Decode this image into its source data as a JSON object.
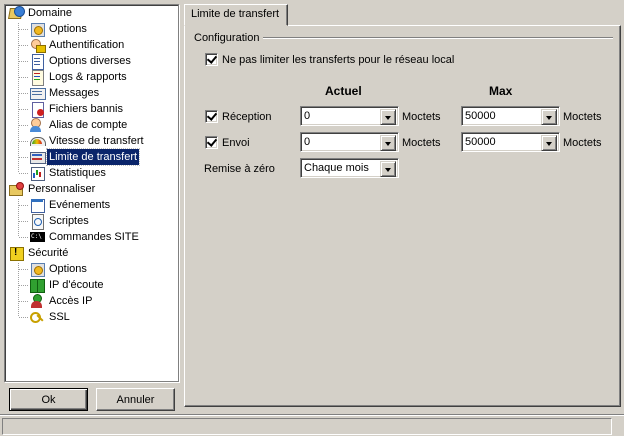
{
  "tree": {
    "items": [
      {
        "label": "Domaine",
        "icon": "domain-icon",
        "level": 0
      },
      {
        "label": "Options",
        "icon": "options-icon",
        "level": 1
      },
      {
        "label": "Authentification",
        "icon": "auth-icon",
        "level": 1
      },
      {
        "label": "Options diverses",
        "icon": "misc-options-icon",
        "level": 1
      },
      {
        "label": "Logs & rapports",
        "icon": "logs-icon",
        "level": 1
      },
      {
        "label": "Messages",
        "icon": "messages-icon",
        "level": 1
      },
      {
        "label": "Fichiers bannis",
        "icon": "banned-files-icon",
        "level": 1
      },
      {
        "label": "Alias de compte",
        "icon": "account-alias-icon",
        "level": 1
      },
      {
        "label": "Vitesse de transfert",
        "icon": "transfer-speed-icon",
        "level": 1
      },
      {
        "label": "Limite de transfert",
        "icon": "transfer-limit-icon",
        "level": 1,
        "selected": true
      },
      {
        "label": "Statistiques",
        "icon": "statistics-icon",
        "level": 1
      },
      {
        "label": "Personnaliser",
        "icon": "customize-icon",
        "level": 0
      },
      {
        "label": "Evénements",
        "icon": "events-icon",
        "level": 1
      },
      {
        "label": "Scriptes",
        "icon": "scripts-icon",
        "level": 1
      },
      {
        "label": "Commandes SITE",
        "icon": "site-commands-icon",
        "level": 1
      },
      {
        "label": "Sécurité",
        "icon": "security-icon",
        "level": 0
      },
      {
        "label": "Options",
        "icon": "security-options-icon",
        "level": 1
      },
      {
        "label": "IP d'écoute",
        "icon": "listen-ip-icon",
        "level": 1
      },
      {
        "label": "Accès IP",
        "icon": "ip-access-icon",
        "level": 1
      },
      {
        "label": "SSL",
        "icon": "ssl-icon",
        "level": 1
      }
    ]
  },
  "buttons": {
    "ok": "Ok",
    "cancel": "Annuler"
  },
  "tab": {
    "label": "Limite de transfert"
  },
  "config": {
    "group_title": "Configuration",
    "no_limit_local": {
      "label": "Ne pas limiter les transferts pour le réseau local",
      "checked": true
    },
    "col_current": "Actuel",
    "col_max": "Max",
    "rows": [
      {
        "label": "Réception",
        "checked": true,
        "current": "0",
        "current_unit": "Moctets",
        "max": "50000",
        "max_unit": "Moctets"
      },
      {
        "label": "Envoi",
        "checked": true,
        "current": "0",
        "current_unit": "Moctets",
        "max": "50000",
        "max_unit": "Moctets"
      }
    ],
    "reset": {
      "label": "Remise à zéro",
      "value": "Chaque mois"
    }
  }
}
